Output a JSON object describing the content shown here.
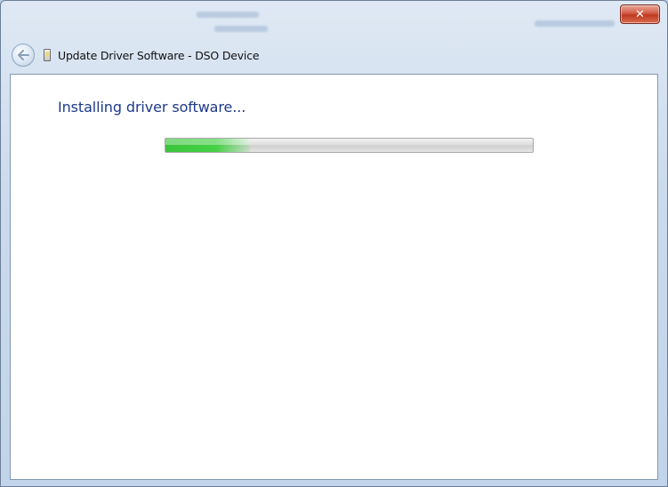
{
  "window": {
    "title": "Update Driver Software - DSO Device",
    "close_glyph": "✕"
  },
  "content": {
    "heading": "Installing driver software..."
  },
  "progress": {
    "percent": 23,
    "color": "#3cc43c"
  },
  "icons": {
    "back": "back-arrow-icon",
    "device": "usb-device-icon",
    "close": "close-icon"
  }
}
